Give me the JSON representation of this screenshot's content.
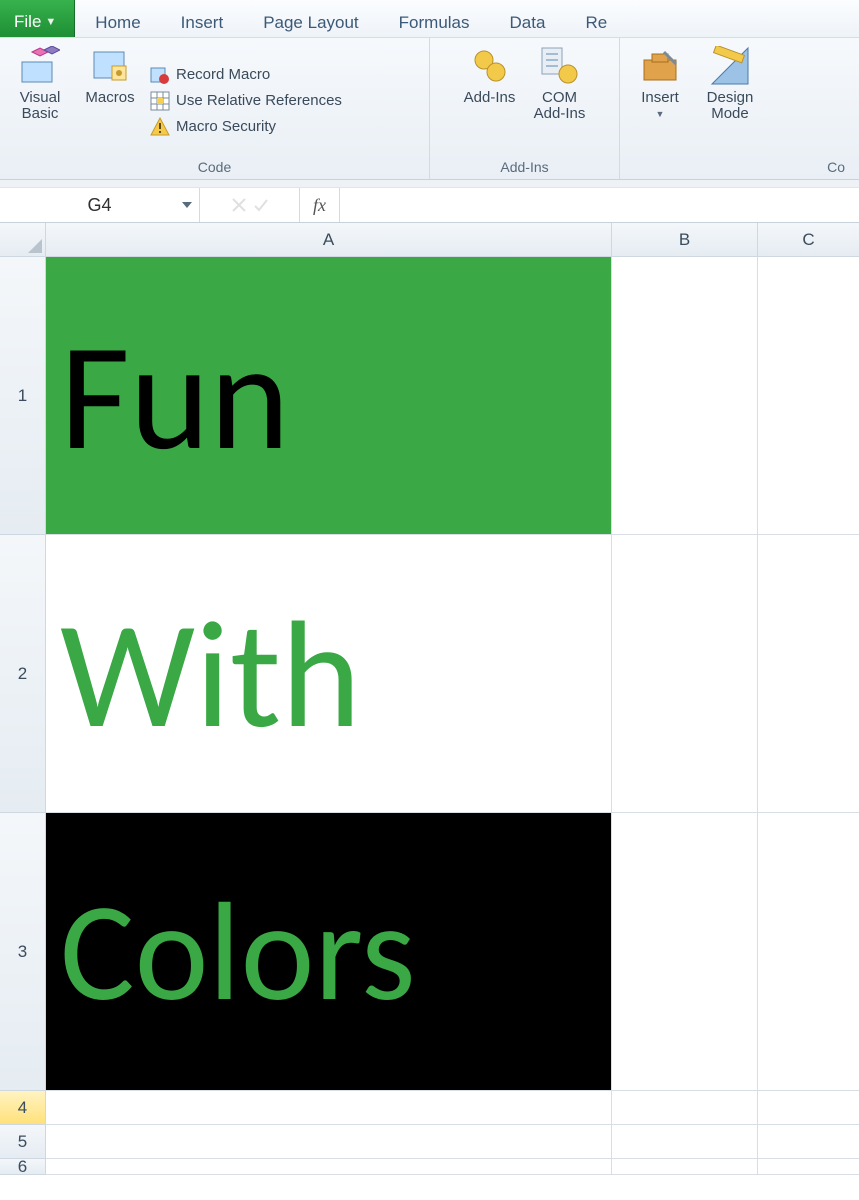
{
  "tabs": {
    "file": "File",
    "items": [
      "Home",
      "Insert",
      "Page Layout",
      "Formulas",
      "Data",
      "Re"
    ]
  },
  "ribbon": {
    "code": {
      "title": "Code",
      "visual_basic": "Visual\nBasic",
      "macros": "Macros",
      "record_macro": "Record Macro",
      "use_relative": "Use Relative References",
      "macro_security": "Macro Security"
    },
    "addins": {
      "title": "Add-Ins",
      "addins": "Add-Ins",
      "com_addins": "COM\nAdd-Ins"
    },
    "controls": {
      "title": "Co",
      "insert": "Insert",
      "design_mode": "Design\nMode"
    }
  },
  "namebox": "G4",
  "fx_label": "fx",
  "columns": [
    "A",
    "B",
    "C"
  ],
  "rows": [
    "1",
    "2",
    "3",
    "4",
    "5",
    "6"
  ],
  "cells": {
    "A1": "Fun",
    "A2": "With",
    "A3": "Colors"
  },
  "colors": {
    "excel_green": "#39a845"
  }
}
